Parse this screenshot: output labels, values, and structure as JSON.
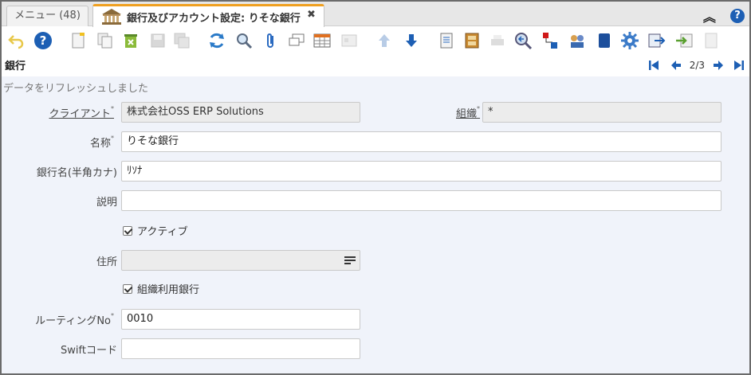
{
  "tabs": {
    "menu_label": "メニュー (48)",
    "active_label": "銀行及びアカウント設定: りそな銀行",
    "close_glyph": "✖"
  },
  "header": {
    "help_glyph": "?",
    "collapse_glyph": "︽"
  },
  "toolbar": {
    "icons": [
      "undo-icon",
      "help-icon",
      "new-record-icon",
      "copy-record-icon",
      "delete-icon",
      "save-icon",
      "save-new-icon",
      "refresh-icon",
      "find-icon",
      "attachment-icon",
      "chat-icon",
      "grid-toggle-icon",
      "parent-record-icon",
      "previous-record-icon",
      "next-record-icon",
      "report-icon",
      "archive-icon",
      "print-icon",
      "zoom-across-icon",
      "workflow-icon",
      "request-icon",
      "product-info-icon",
      "process-icon",
      "export-icon",
      "import-icon",
      "post-icon"
    ]
  },
  "page": {
    "title": "銀行",
    "record_count": "2/3",
    "status_message": "データをリフレッシュしました"
  },
  "form": {
    "client_label": "クライアント",
    "client_value": "株式会社OSS ERP Solutions",
    "org_label": "組織",
    "org_value": "*",
    "name_label": "名称",
    "name_value": "りそな銀行",
    "name_kana_label": "銀行名(半角カナ)",
    "name_kana_value": "ﾘｿﾅ",
    "description_label": "説明",
    "description_value": "",
    "active_label": "アクティブ",
    "address_label": "住所",
    "address_value": "",
    "own_bank_label": "組織利用銀行",
    "routing_label": "ルーティングNo",
    "routing_value": "0010",
    "swift_label": "Swiftコード",
    "swift_value": ""
  },
  "colors": {
    "accent": "#1d5fb4",
    "tab_accent": "#f0a020",
    "form_bg": "#f0f3fa"
  }
}
